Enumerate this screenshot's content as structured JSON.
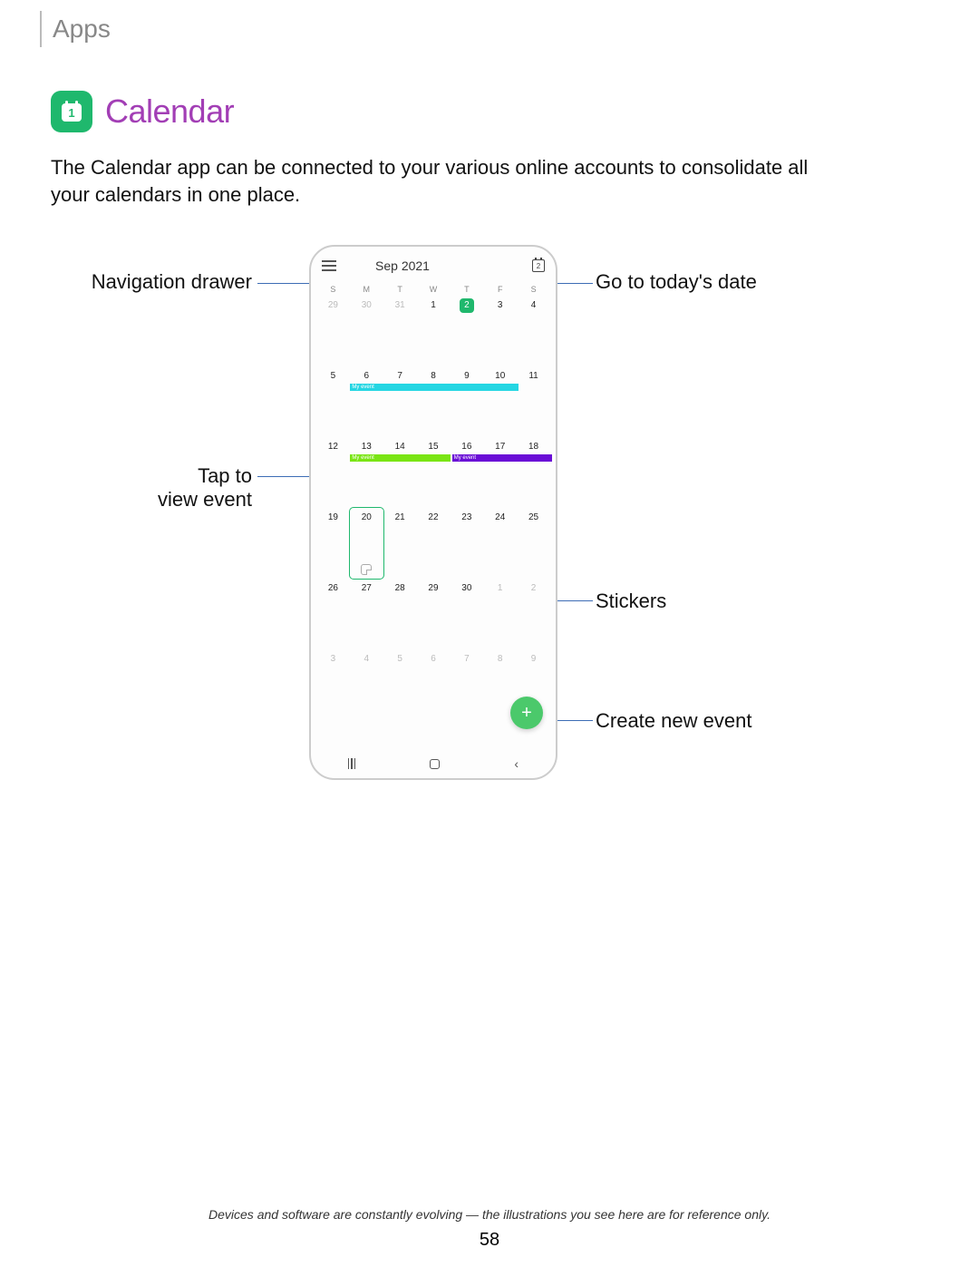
{
  "header": {
    "section": "Apps"
  },
  "title": {
    "app_name": "Calendar",
    "icon_date": "1"
  },
  "description": "The Calendar app can be connected to your various online accounts to consolidate all your calendars in one place.",
  "callouts": {
    "navigation_drawer": "Navigation drawer",
    "go_to_today": "Go to today's date",
    "tap_to_view_line1": "Tap to",
    "tap_to_view_line2": "view event",
    "stickers": "Stickers",
    "create_new_event": "Create new event"
  },
  "phone": {
    "month_label": "Sep 2021",
    "today_icon_num": "2",
    "weekdays": [
      "S",
      "M",
      "T",
      "W",
      "T",
      "F",
      "S"
    ],
    "weeks": [
      [
        {
          "n": "29",
          "dim": true
        },
        {
          "n": "30",
          "dim": true
        },
        {
          "n": "31",
          "dim": true
        },
        {
          "n": "1"
        },
        {
          "n": "2",
          "today": true
        },
        {
          "n": "3"
        },
        {
          "n": "4"
        }
      ],
      [
        {
          "n": "5"
        },
        {
          "n": "6"
        },
        {
          "n": "7"
        },
        {
          "n": "8"
        },
        {
          "n": "9"
        },
        {
          "n": "10"
        },
        {
          "n": "11"
        }
      ],
      [
        {
          "n": "12"
        },
        {
          "n": "13"
        },
        {
          "n": "14"
        },
        {
          "n": "15"
        },
        {
          "n": "16"
        },
        {
          "n": "17"
        },
        {
          "n": "18"
        }
      ],
      [
        {
          "n": "19"
        },
        {
          "n": "20",
          "selected": true,
          "sticker": true
        },
        {
          "n": "21"
        },
        {
          "n": "22"
        },
        {
          "n": "23"
        },
        {
          "n": "24"
        },
        {
          "n": "25"
        }
      ],
      [
        {
          "n": "26"
        },
        {
          "n": "27"
        },
        {
          "n": "28"
        },
        {
          "n": "29"
        },
        {
          "n": "30"
        },
        {
          "n": "1",
          "dim": true
        },
        {
          "n": "2",
          "dim": true
        }
      ],
      [
        {
          "n": "3",
          "dim": true
        },
        {
          "n": "4",
          "dim": true
        },
        {
          "n": "5",
          "dim": true
        },
        {
          "n": "6",
          "dim": true
        },
        {
          "n": "7",
          "dim": true
        },
        {
          "n": "8",
          "dim": true
        },
        {
          "n": "9",
          "dim": true
        }
      ]
    ],
    "events": [
      {
        "row": 1,
        "start": 1,
        "span": 5,
        "label": "My event",
        "color": "#24d6e3"
      },
      {
        "row": 2,
        "start": 1,
        "span": 3,
        "label": "My event",
        "color": "#7ae514"
      },
      {
        "row": 2,
        "start": 4,
        "span": 3,
        "label": "My event",
        "color": "#6a0dd6"
      }
    ],
    "fab_label": "+"
  },
  "footer": {
    "note": "Devices and software are constantly evolving — the illustrations you see here are for reference only.",
    "page": "58"
  }
}
